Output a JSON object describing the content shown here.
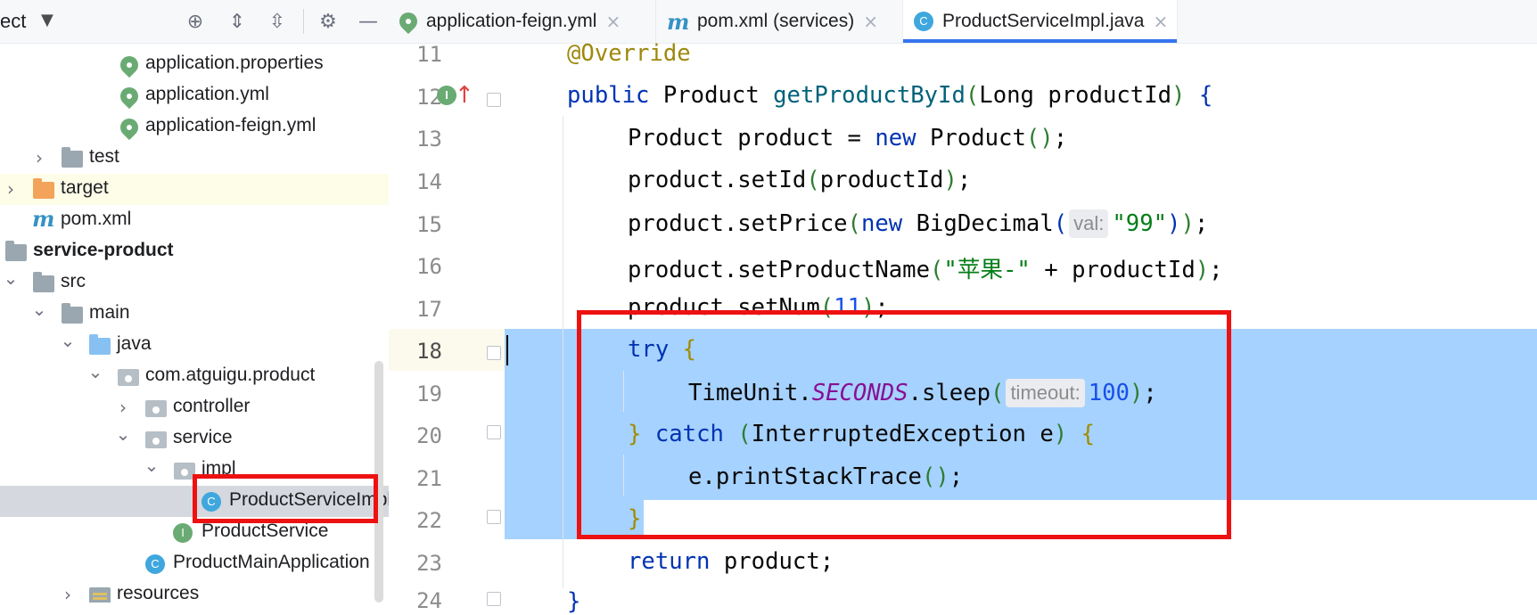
{
  "project_panel": {
    "title": "ect",
    "header_icons": [
      "crosshair-icon",
      "expand-all-icon",
      "collapse-all-icon",
      "gear-icon",
      "minimize-icon"
    ],
    "tree": [
      {
        "label": "application.properties",
        "icon": "spring-config-icon",
        "chevron": ""
      },
      {
        "label": "application.yml",
        "icon": "spring-config-icon",
        "chevron": ""
      },
      {
        "label": "application-feign.yml",
        "icon": "spring-config-icon",
        "chevron": ""
      },
      {
        "label": "test",
        "icon": "folder-icon",
        "chevron": "›"
      },
      {
        "label": "target",
        "icon": "folder-orange-icon",
        "chevron": "›"
      },
      {
        "label": "pom.xml",
        "icon": "maven-icon",
        "chevron": ""
      },
      {
        "label": "service-product",
        "icon": "module-icon",
        "chevron": "⌄"
      },
      {
        "label": "src",
        "icon": "folder-icon",
        "chevron": "⌄"
      },
      {
        "label": "main",
        "icon": "folder-icon",
        "chevron": "⌄"
      },
      {
        "label": "java",
        "icon": "source-folder-icon",
        "chevron": "⌄"
      },
      {
        "label": "com.atguigu.product",
        "icon": "package-icon",
        "chevron": "⌄"
      },
      {
        "label": "controller",
        "icon": "package-icon",
        "chevron": "›"
      },
      {
        "label": "service",
        "icon": "package-icon",
        "chevron": "⌄"
      },
      {
        "label": "impl",
        "icon": "package-icon",
        "chevron": "⌄"
      },
      {
        "label": "ProductServiceImpl",
        "icon": "class-icon",
        "chevron": ""
      },
      {
        "label": "ProductService",
        "icon": "interface-icon",
        "chevron": ""
      },
      {
        "label": "ProductMainApplication",
        "icon": "spring-boot-class-icon",
        "chevron": ""
      },
      {
        "label": "resources",
        "icon": "resources-folder-icon",
        "chevron": "›"
      }
    ]
  },
  "tabs": [
    {
      "label": "application-feign.yml",
      "icon": "spring-config-icon",
      "active": false
    },
    {
      "label": "pom.xml (services)",
      "icon": "maven-icon",
      "active": false
    },
    {
      "label": "ProductServiceImpl.java",
      "icon": "class-icon",
      "active": true
    }
  ],
  "tab_close_glyph": "×",
  "editor": {
    "line_numbers": [
      "11",
      "12",
      "13",
      "14",
      "15",
      "16",
      "17",
      "18",
      "19",
      "20",
      "21",
      "22",
      "23",
      "24"
    ],
    "hints": {
      "val": "val:",
      "timeout": "timeout:"
    },
    "lines": {
      "l11": "@Override",
      "l12_kw": "public",
      "l12_type": " Product ",
      "l12_meth": "getProductById",
      "l12_params": "Long productId",
      "l13_a": "Product product = ",
      "l13_kw": "new",
      "l13_b": " Product",
      "l14": "product.setId",
      "l14_arg": "productId",
      "l15_a": "product.setPrice",
      "l15_kw": "new",
      "l15_b": " BigDecimal",
      "l15_str": "\"99\"",
      "l16_a": "product.setProductName",
      "l16_str": "\"苹果-\"",
      "l16_b": " + productId",
      "l17_a": "product.setNum",
      "l17_num": "11",
      "l18_kw": "try",
      "l19_a": "TimeUnit.",
      "l19_const": "SECONDS",
      "l19_b": ".sleep",
      "l19_num": "100",
      "l20_kw": "catch",
      "l20_ex": "InterruptedException e",
      "l21": "e.printStackTrace",
      "l23_kw": "return",
      "l23_b": " product;"
    }
  }
}
